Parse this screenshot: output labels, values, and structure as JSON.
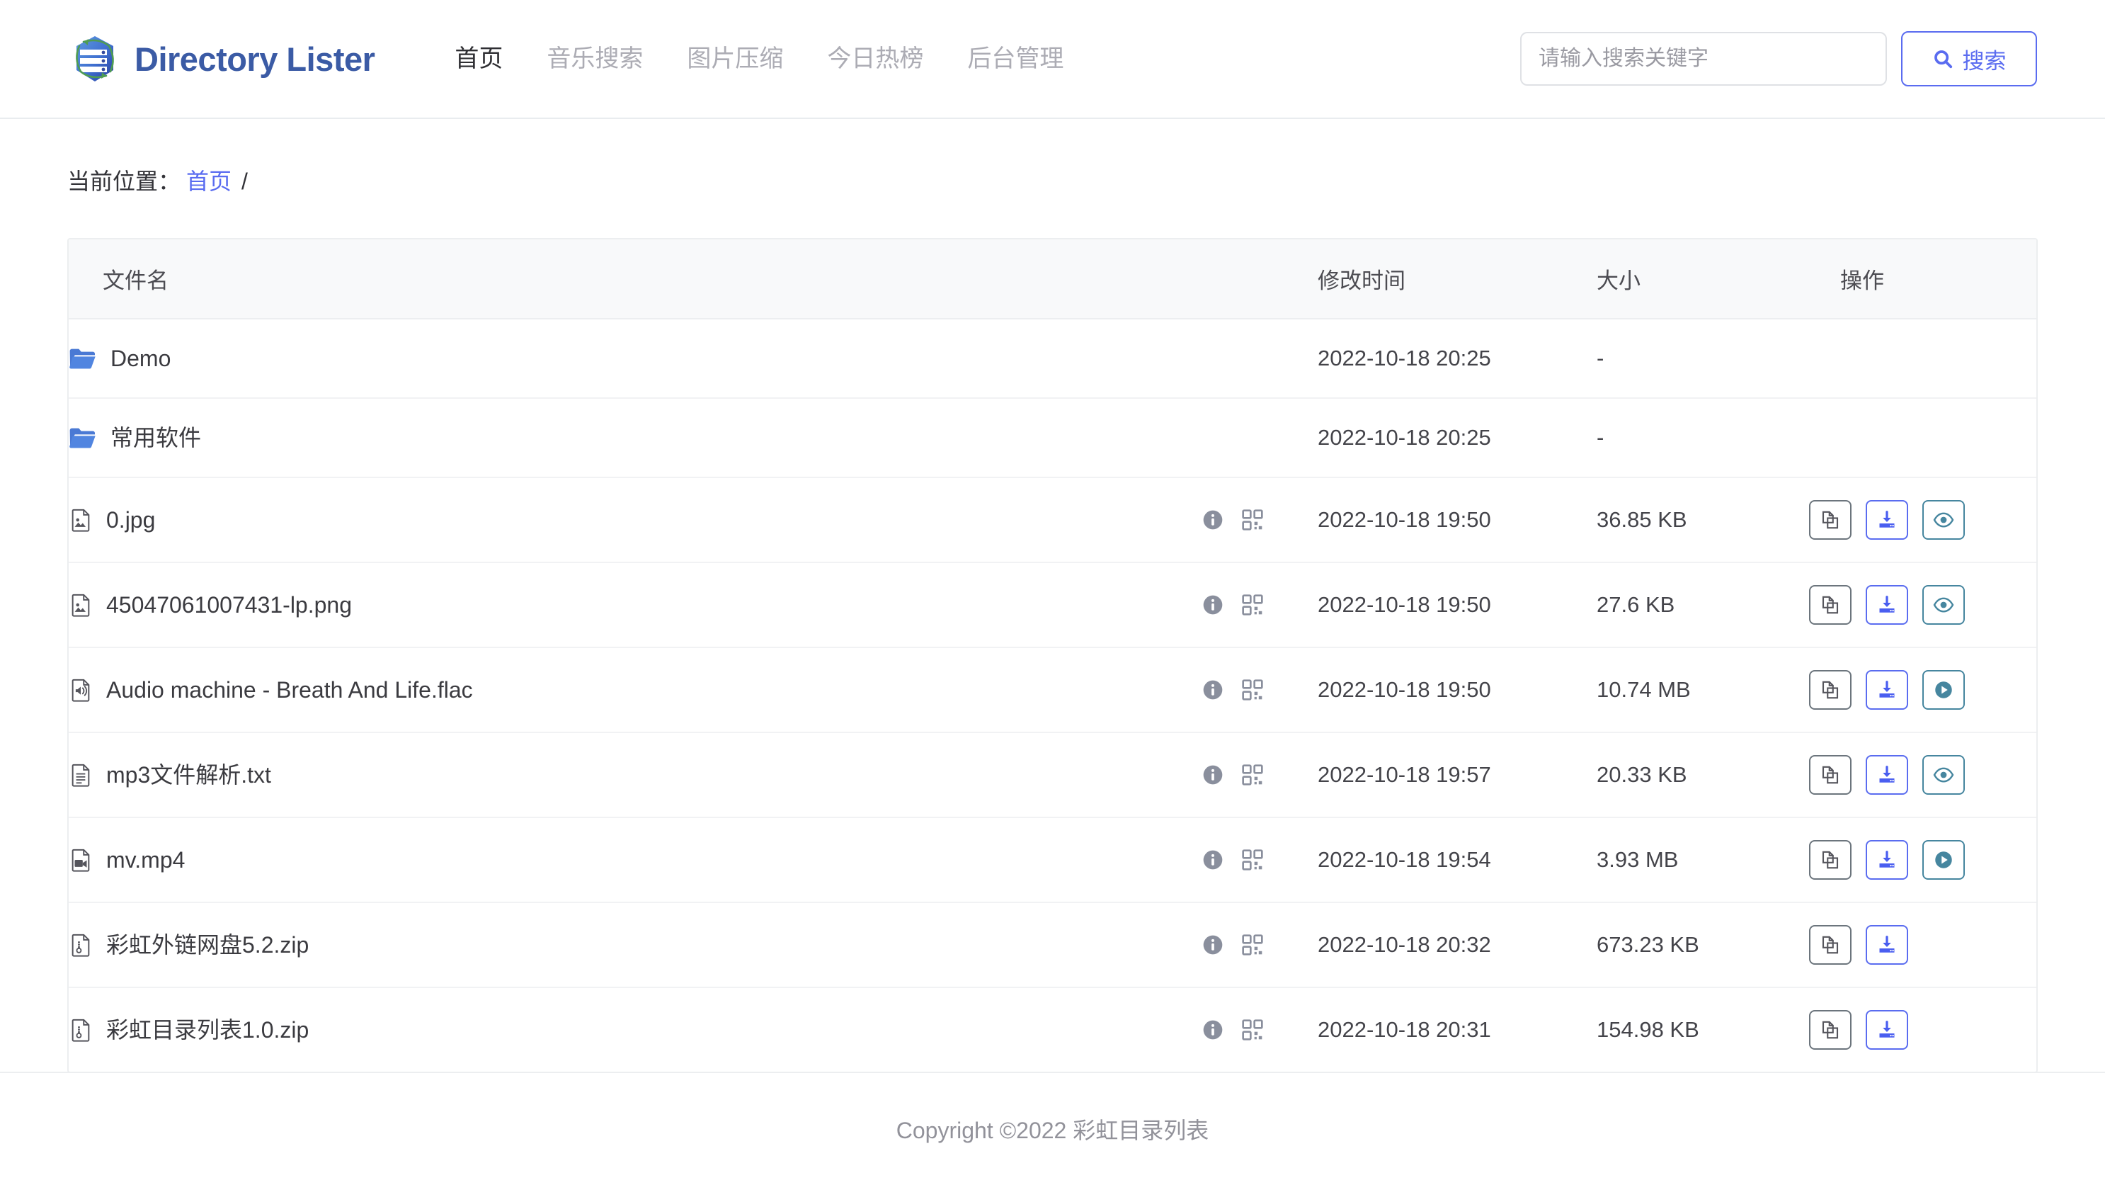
{
  "brand": {
    "name": "Directory Lister",
    "logo_icon": "directory-lister-logo"
  },
  "nav": {
    "items": [
      {
        "label": "首页",
        "active": true
      },
      {
        "label": "音乐搜索",
        "active": false
      },
      {
        "label": "图片压缩",
        "active": false
      },
      {
        "label": "今日热榜",
        "active": false
      },
      {
        "label": "后台管理",
        "active": false
      }
    ]
  },
  "search": {
    "placeholder": "请输入搜索关键字",
    "value": "",
    "button_label": "搜索",
    "button_icon": "search-icon",
    "accent_color": "#5a6cf0"
  },
  "breadcrumb": {
    "label": "当前位置：",
    "home": "首页",
    "separator": "/"
  },
  "table": {
    "headers": {
      "name": "文件名",
      "badges": "",
      "time": "修改时间",
      "size": "大小",
      "ops": "操作"
    },
    "rows": [
      {
        "name": "Demo",
        "icon": "folder-icon",
        "type": "folder",
        "time": "2022-10-18 20:25",
        "size": "-",
        "badges": [],
        "ops": []
      },
      {
        "name": "常用软件",
        "icon": "folder-icon",
        "type": "folder",
        "time": "2022-10-18 20:25",
        "size": "-",
        "badges": [],
        "ops": []
      },
      {
        "name": "0.jpg",
        "icon": "file-image-icon",
        "type": "image",
        "time": "2022-10-18 19:50",
        "size": "36.85 KB",
        "badges": [
          "info-icon",
          "qrcode-icon"
        ],
        "ops": [
          "copy-icon",
          "download-icon",
          "eye-icon"
        ]
      },
      {
        "name": "45047061007431-lp.png",
        "icon": "file-image-icon",
        "type": "image",
        "time": "2022-10-18 19:50",
        "size": "27.6 KB",
        "badges": [
          "info-icon",
          "qrcode-icon"
        ],
        "ops": [
          "copy-icon",
          "download-icon",
          "eye-icon"
        ]
      },
      {
        "name": "Audio machine - Breath And Life.flac",
        "icon": "file-audio-icon",
        "type": "audio",
        "time": "2022-10-18 19:50",
        "size": "10.74 MB",
        "badges": [
          "info-icon",
          "qrcode-icon"
        ],
        "ops": [
          "copy-icon",
          "download-icon",
          "play-icon"
        ]
      },
      {
        "name": "mp3文件解析.txt",
        "icon": "file-text-icon",
        "type": "text",
        "time": "2022-10-18 19:57",
        "size": "20.33 KB",
        "badges": [
          "info-icon",
          "qrcode-icon"
        ],
        "ops": [
          "copy-icon",
          "download-icon",
          "eye-icon"
        ]
      },
      {
        "name": "mv.mp4",
        "icon": "file-video-icon",
        "type": "video",
        "time": "2022-10-18 19:54",
        "size": "3.93 MB",
        "badges": [
          "info-icon",
          "qrcode-icon"
        ],
        "ops": [
          "copy-icon",
          "download-icon",
          "play-icon"
        ]
      },
      {
        "name": "彩虹外链网盘5.2.zip",
        "icon": "file-archive-icon",
        "type": "archive",
        "time": "2022-10-18 20:32",
        "size": "673.23 KB",
        "badges": [
          "info-icon",
          "qrcode-icon"
        ],
        "ops": [
          "copy-icon",
          "download-icon"
        ]
      },
      {
        "name": "彩虹目录列表1.0.zip",
        "icon": "file-archive-icon",
        "type": "archive",
        "time": "2022-10-18 20:31",
        "size": "154.98 KB",
        "badges": [
          "info-icon",
          "qrcode-icon"
        ],
        "ops": [
          "copy-icon",
          "download-icon"
        ]
      }
    ]
  },
  "footer": {
    "text": "Copyright ©2022 彩虹目录列表"
  },
  "colors": {
    "link": "#5a6cf0",
    "folder": "#4a79d4",
    "download": "#4a5ef0",
    "preview": "#46869f",
    "copy": "#6c757d"
  }
}
